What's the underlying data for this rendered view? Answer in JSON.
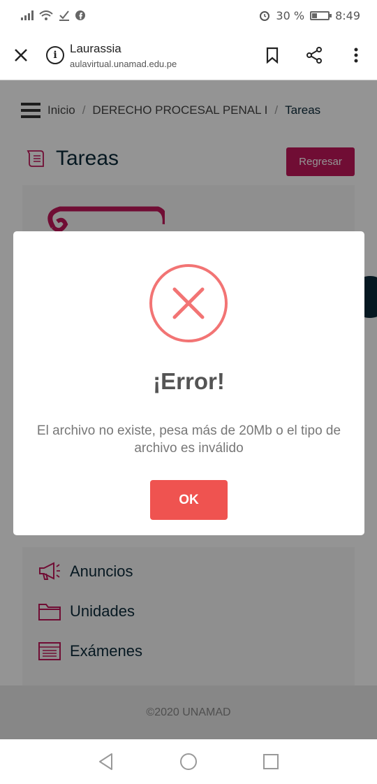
{
  "status_bar": {
    "battery_percent": "30 %",
    "time": "8:49"
  },
  "browser": {
    "site_title": "Laurassia",
    "url": "aulavirtual.unamad.edu.pe"
  },
  "breadcrumb": {
    "items": [
      "Inicio",
      "DERECHO PROCESAL PENAL I",
      "Tareas"
    ],
    "separator": "/"
  },
  "page": {
    "title": "Tareas",
    "back_button": "Regresar"
  },
  "menu": {
    "items": [
      {
        "label": "Anuncios",
        "icon": "megaphone-icon"
      },
      {
        "label": "Unidades",
        "icon": "folder-icon"
      },
      {
        "label": "Exámenes",
        "icon": "list-icon"
      }
    ]
  },
  "footer": {
    "text": "©2020 UNAMAD"
  },
  "modal": {
    "title": "¡Error!",
    "message": "El archivo no existe, pesa más de 20Mb o el tipo de archivo es inválido",
    "ok_label": "OK"
  },
  "colors": {
    "accent": "#c2185b",
    "error": "#f27474",
    "ok_button": "#ef5350",
    "dark_text": "#0c2a3a"
  }
}
